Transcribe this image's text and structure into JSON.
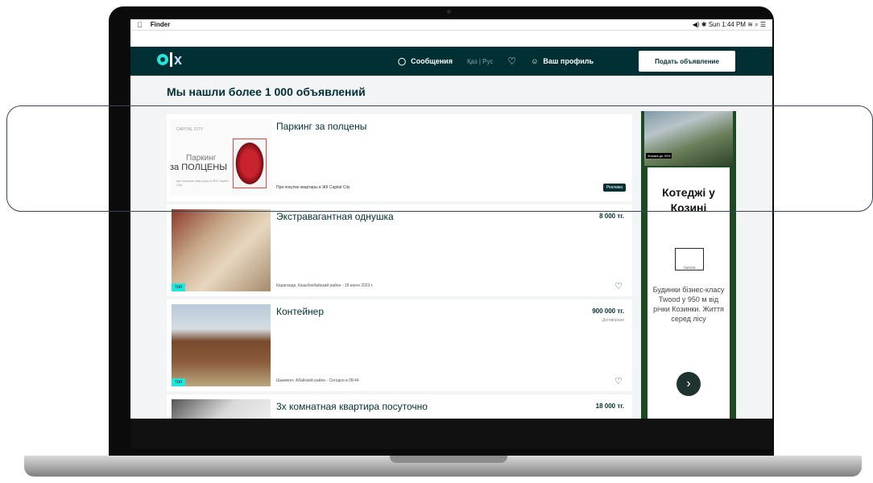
{
  "menubar": {
    "app": "Finder",
    "status": "◀) ✱ Sun 1:44 PM ≋ ⌕ ☰"
  },
  "header": {
    "messages": "Сообщения",
    "lang": "Қаз | Рус",
    "profile": "Ваш профиль",
    "post_button": "Подать объявление"
  },
  "found_text": "Мы нашли более 1 000 объявлений",
  "ad_listing": {
    "title": "Паркинг за полцены",
    "img_brand": "CAPITAL CITY",
    "img_line1": "Паркинг",
    "img_line2": "за ПОЛЦЕНЫ",
    "img_line3": "при покупке квартиры в ЖК Capital City",
    "note": "При покупке квартиры в ЖК Capital City",
    "badge": "Реклама"
  },
  "listings": [
    {
      "title": "Экстравагантная однушка",
      "price": "8 000 тг.",
      "sub": "",
      "location": "Караганда, Казыбекбийский район - 18 июня 2023 г.",
      "top": "топ"
    },
    {
      "title": "Контейнер",
      "price": "900 000 тг.",
      "sub": "Договорная",
      "location": "Шымкент, Абайский район - Сегодня в 08:44",
      "top": "топ"
    },
    {
      "title": "3х комнатная квартира посуточно",
      "price": "18 000 тг.",
      "sub": "",
      "location": "",
      "top": ""
    }
  ],
  "side_banner": {
    "photo_badge": "Знижка до 30%",
    "title": "Котеджі у Козині",
    "logo": "TWOOD",
    "text": "Будинки бізнес-класу Twood у 950 м від річки Козинки. Життя серед лісу"
  },
  "colors": {
    "header": "#002f34",
    "accent": "#23e5db",
    "banner": "#1d4a23"
  }
}
